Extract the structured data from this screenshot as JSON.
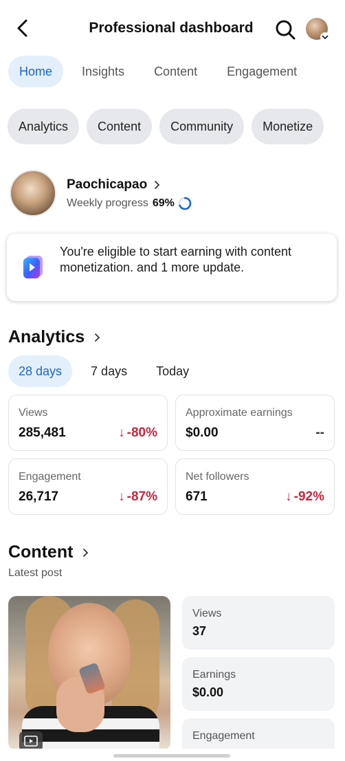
{
  "header": {
    "title": "Professional dashboard",
    "back_icon": "chevron-left-icon",
    "search_icon": "search-icon"
  },
  "tabs": [
    {
      "label": "Home",
      "active": true
    },
    {
      "label": "Insights",
      "active": false
    },
    {
      "label": "Content",
      "active": false
    },
    {
      "label": "Engagement",
      "active": false
    }
  ],
  "chips": [
    "Analytics",
    "Content",
    "Community",
    "Monetize"
  ],
  "profile": {
    "name": "Paochicapao",
    "progress_label": "Weekly progress",
    "progress_value": "69%",
    "progress_fraction": 0.69
  },
  "notice": {
    "text": "You're eligible to start earning with content monetization. and 1 more update."
  },
  "analytics": {
    "title": "Analytics",
    "ranges": [
      {
        "label": "28 days",
        "active": true
      },
      {
        "label": "7 days",
        "active": false
      },
      {
        "label": "Today",
        "active": false
      }
    ],
    "cards": [
      {
        "label": "Views",
        "value": "285,481",
        "delta": "-80%"
      },
      {
        "label": "Approximate earnings",
        "value": "$0.00",
        "delta": "--"
      },
      {
        "label": "Engagement",
        "value": "26,717",
        "delta": "-87%"
      },
      {
        "label": "Net followers",
        "value": "671",
        "delta": "-92%"
      }
    ]
  },
  "content": {
    "title": "Content",
    "subtitle": "Latest post",
    "stats": [
      {
        "label": "Views",
        "value": "37"
      },
      {
        "label": "Earnings",
        "value": "$0.00"
      },
      {
        "label": "Engagement",
        "value": ""
      }
    ]
  },
  "colors": {
    "accent": "#1a67c9",
    "accent_bg": "#e3effb",
    "negative": "#c6283d",
    "chip_bg": "#e6e8eb"
  }
}
